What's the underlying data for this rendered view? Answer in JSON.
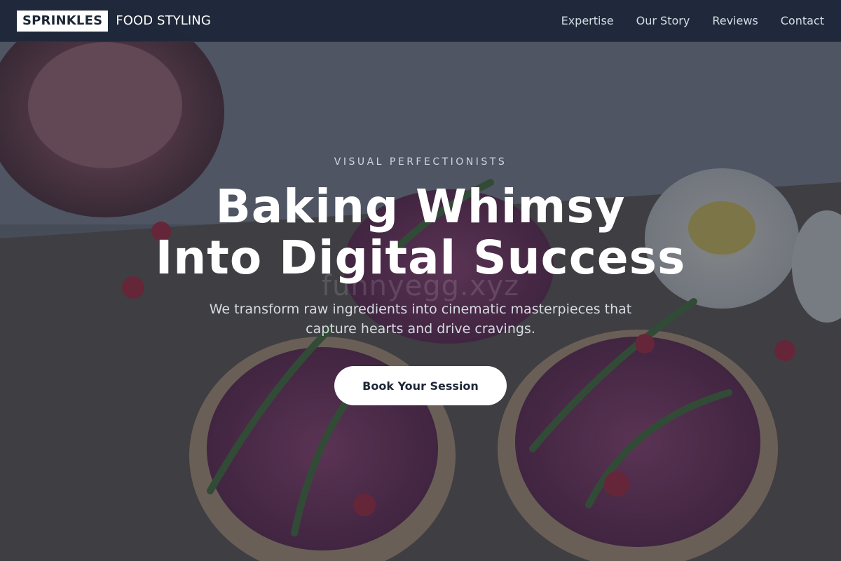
{
  "brand": {
    "logo_box": "SPRINKLES",
    "logo_text": "FOOD STYLING"
  },
  "nav": {
    "links": [
      "Expertise",
      "Our Story",
      "Reviews",
      "Contact"
    ]
  },
  "hero": {
    "eyebrow": "VISUAL PERFECTIONISTS",
    "headline_line1": "Baking Whimsy",
    "headline_line2": "Into Digital Success",
    "watermark": "funnyegg.xyz",
    "subheading": "We transform raw ingredients into cinematic masterpieces that capture hearts and drive cravings.",
    "cta_label": "Book Your Session",
    "background_image": "toast-with-beet-spread-arugula-pomegranate"
  },
  "colors": {
    "nav_bg": "#1e283a",
    "cta_bg": "#ffffff",
    "cta_text": "#1d2636",
    "overlay": "#1c2434"
  }
}
